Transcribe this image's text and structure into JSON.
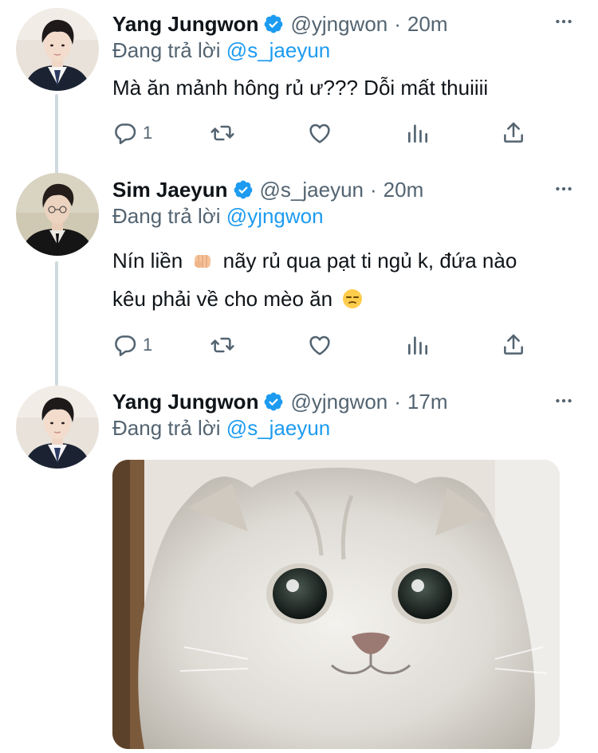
{
  "tweets": [
    {
      "name": "Yang Jungwon",
      "handle": "@yjngwon",
      "separator": "·",
      "time": "20m",
      "reply_prefix": "Đang trả lời",
      "reply_mention": "@s_jaeyun",
      "text": "Mà ăn mảnh hông rủ ư??? Dỗi mất thuiiii",
      "reply_count": "1"
    },
    {
      "name": "Sim Jaeyun",
      "handle": "@s_jaeyun",
      "separator": "·",
      "time": "20m",
      "reply_prefix": "Đang trả lời",
      "reply_mention": "@yjngwon",
      "text_part1": "Nín liền",
      "text_part2": "nãy rủ qua pạt ti ngủ k, đứa nào",
      "text_line2": "kêu phải về cho mèo ăn",
      "emoji1": "oncoming-fist",
      "emoji2": "unamused-face",
      "reply_count": "1"
    },
    {
      "name": "Yang Jungwon",
      "handle": "@yjngwon",
      "separator": "·",
      "time": "17m",
      "reply_prefix": "Đang trả lời",
      "reply_mention": "@s_jaeyun",
      "media": "cat-photo"
    }
  ],
  "icons": [
    "reply-icon",
    "retweet-icon",
    "like-icon",
    "analytics-icon",
    "share-icon",
    "verified-icon",
    "more-icon"
  ],
  "colors": {
    "link": "#1d9bf0",
    "secondary": "#536471",
    "verified": "#1d9bf0",
    "thread_line": "#cfd9de"
  }
}
